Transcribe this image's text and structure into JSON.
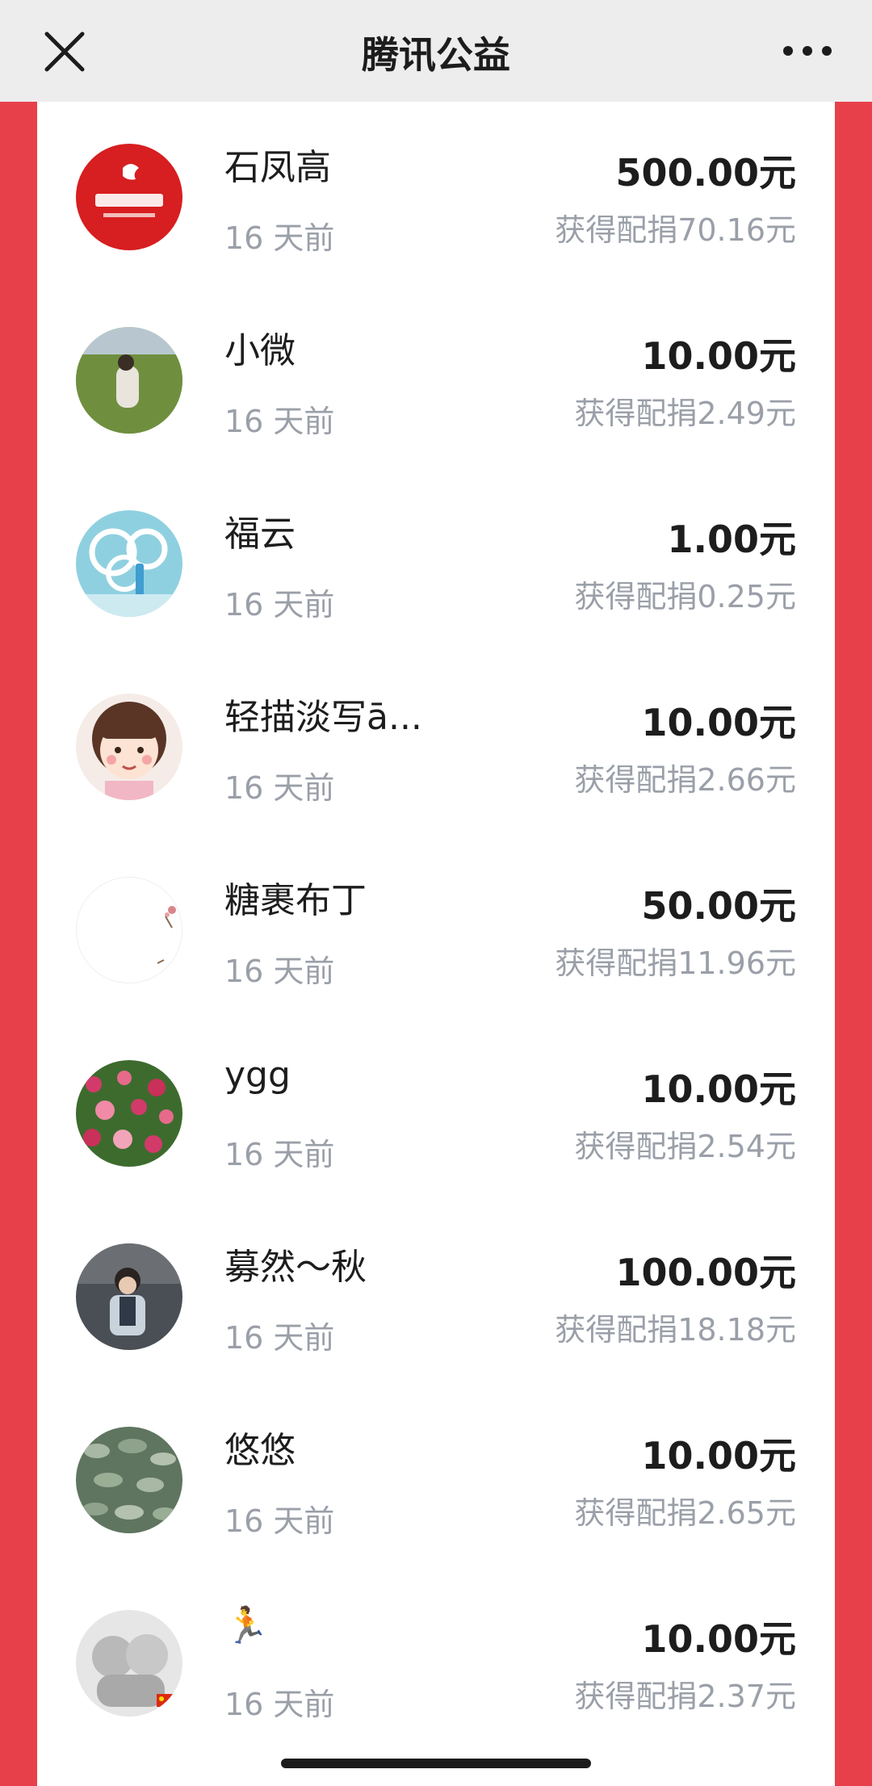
{
  "header": {
    "title": "腾讯公益",
    "close_icon": "close-icon",
    "more_icon": "more-dots-icon"
  },
  "colors": {
    "side_band": "#e8404a",
    "topbar": "#ededed",
    "secondary_text": "#9a9fa8"
  },
  "donations": [
    {
      "name": "石凤高",
      "time": "16 天前",
      "amount": "500.00元",
      "match": "获得配捐70.16元",
      "avatar": "brand-logo-avatar"
    },
    {
      "name": "小微",
      "time": "16 天前",
      "amount": "10.00元",
      "match": "获得配捐2.49元",
      "avatar": "field-photo-avatar"
    },
    {
      "name": "福云",
      "time": "16 天前",
      "amount": "1.00元",
      "match": "获得配捐0.25元",
      "avatar": "rings-photo-avatar"
    },
    {
      "name": "轻描淡写ā...",
      "time": "16 天前",
      "amount": "10.00元",
      "match": "获得配捐2.66元",
      "avatar": "cartoon-girl-avatar"
    },
    {
      "name": "糖裹布丁",
      "time": "16 天前",
      "amount": "50.00元",
      "match": "获得配捐11.96元",
      "avatar": "flower-sketch-avatar"
    },
    {
      "name": "ygg",
      "time": "16 天前",
      "amount": "10.00元",
      "match": "获得配捐2.54元",
      "avatar": "flower-garden-avatar"
    },
    {
      "name": "募然～秋",
      "time": "16 天前",
      "amount": "100.00元",
      "match": "获得配捐18.18元",
      "avatar": "child-photo-avatar"
    },
    {
      "name": "悠悠",
      "time": "16 天前",
      "amount": "10.00元",
      "match": "获得配捐2.65元",
      "avatar": "leaves-photo-avatar"
    },
    {
      "name": "🏃",
      "time": "16 天前",
      "amount": "10.00元",
      "match": "获得配捐2.37元",
      "avatar": "babies-photo-avatar"
    }
  ]
}
